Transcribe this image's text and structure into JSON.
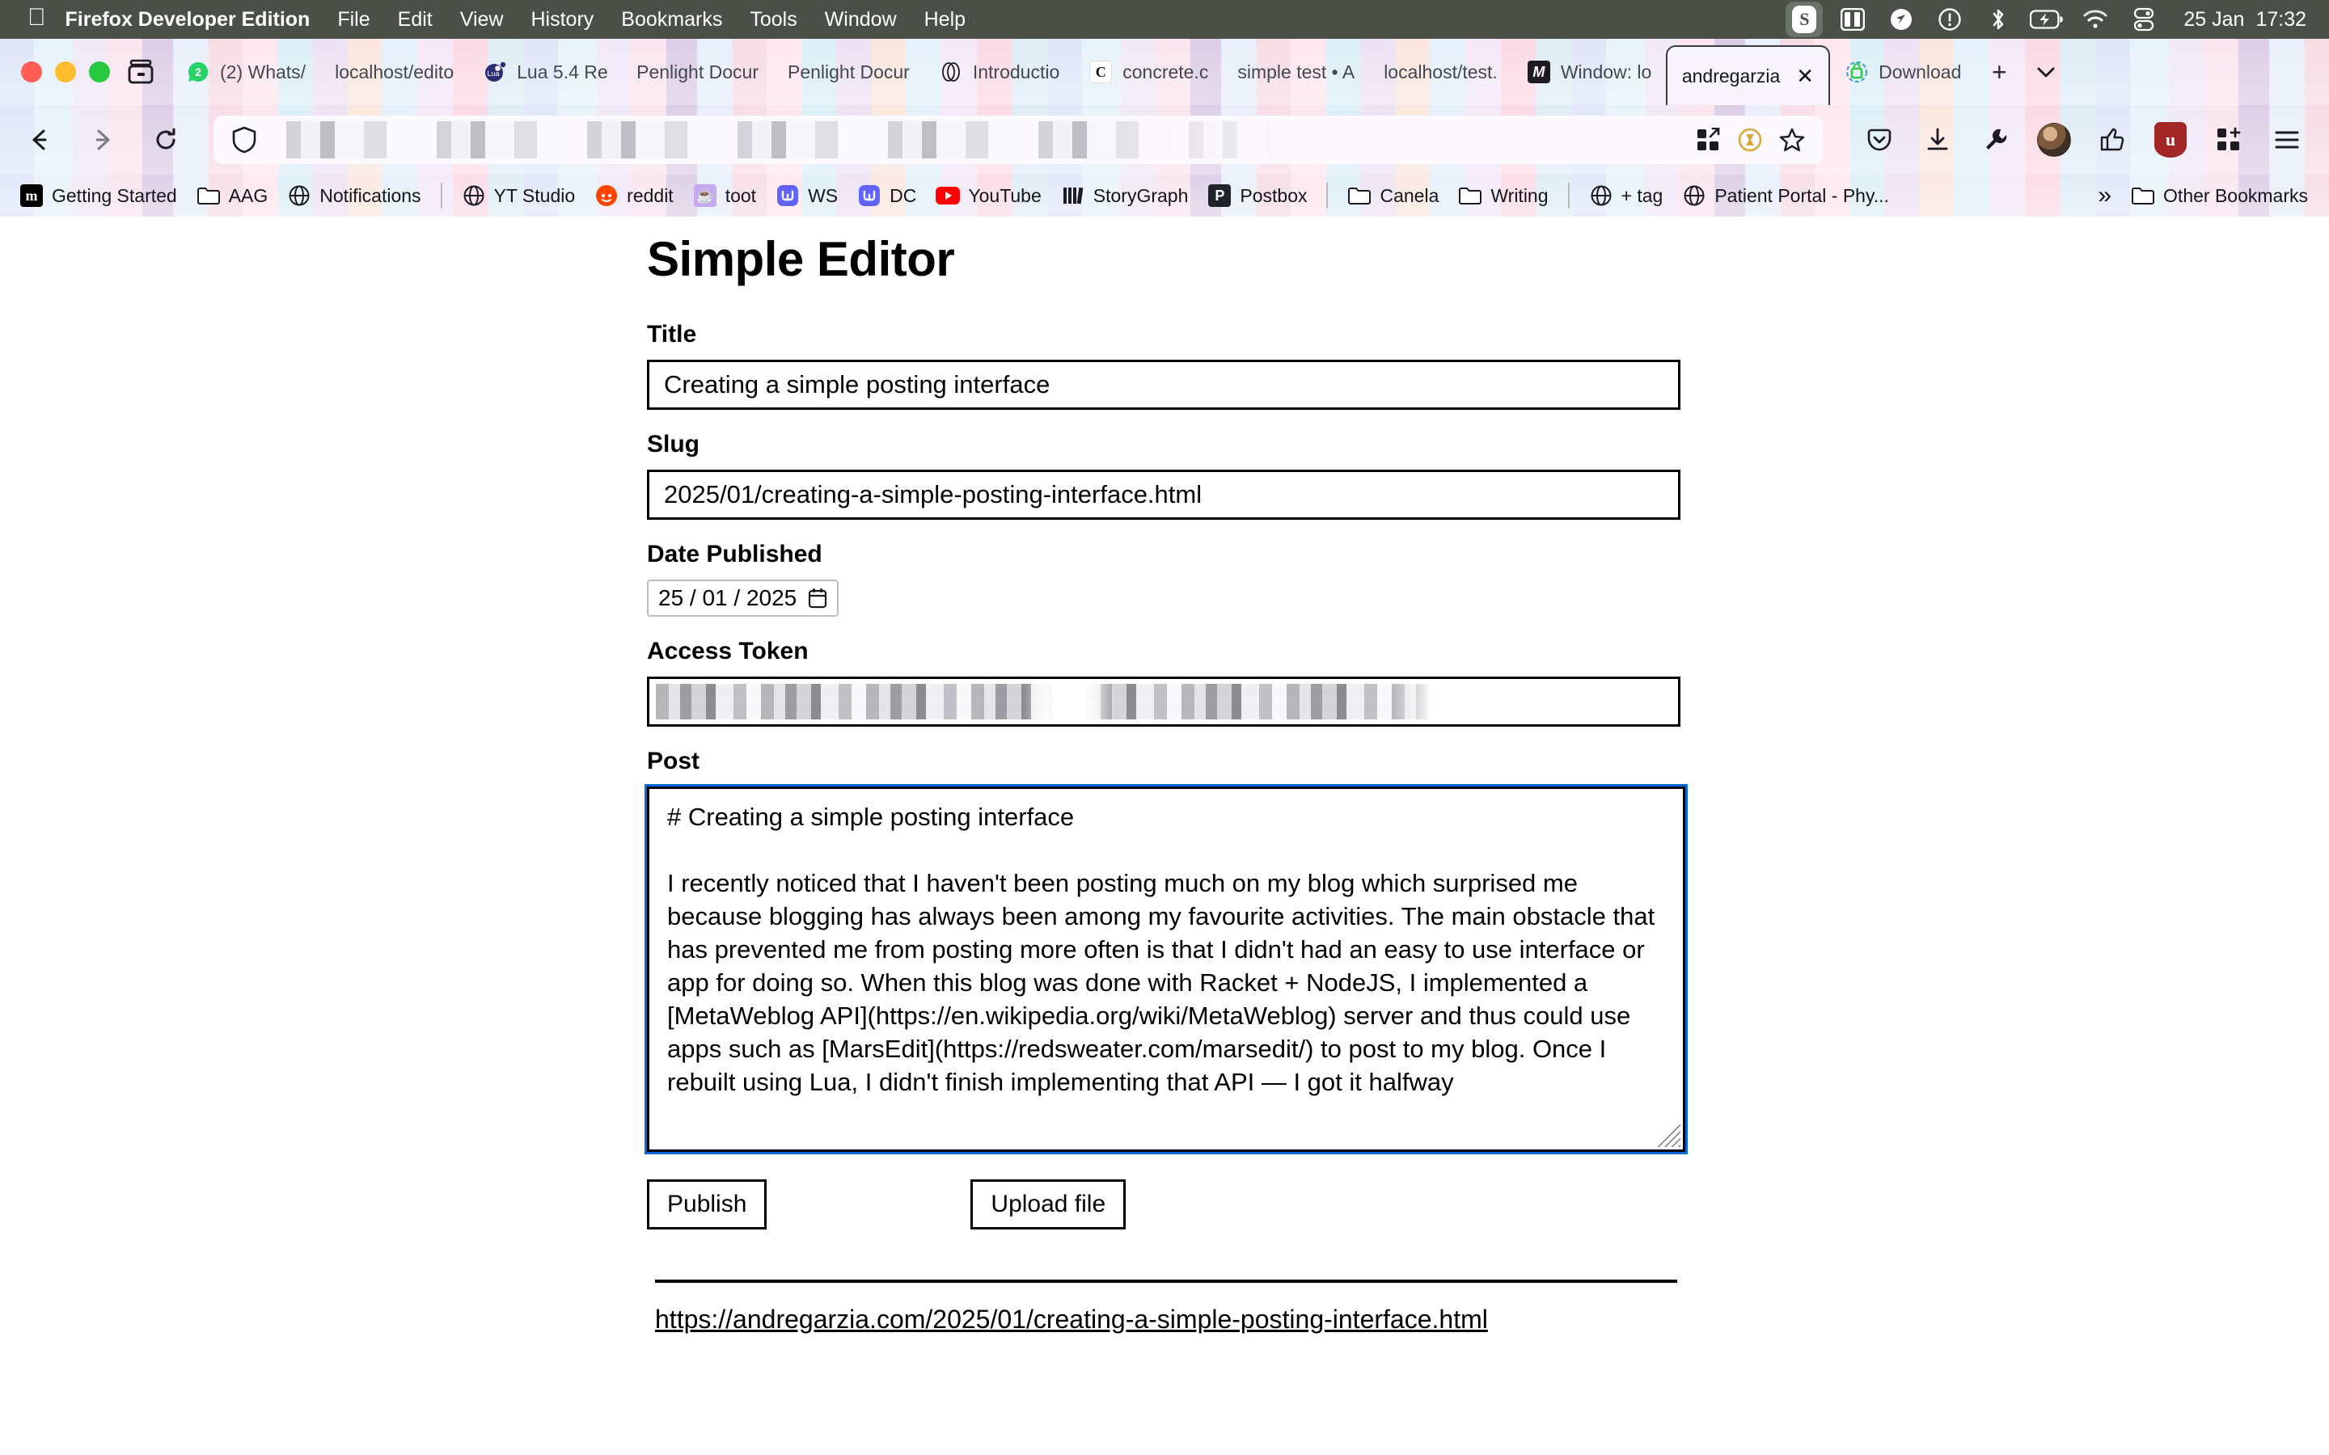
{
  "menubar": {
    "apple_icon": "apple-logo-icon",
    "app_name": "Firefox Developer Edition",
    "items": [
      "File",
      "Edit",
      "View",
      "History",
      "Bookmarks",
      "Tools",
      "Window",
      "Help"
    ],
    "status_icons": [
      "stage-manager-icon",
      "split-view-icon",
      "location-arrow-icon",
      "notification-warning-icon",
      "bluetooth-icon",
      "battery-charging-icon",
      "wifi-icon",
      "control-center-icon"
    ],
    "stage_badge_letter": "S",
    "date": "25 Jan",
    "time": "17:32"
  },
  "window_controls": {
    "close": "close-window-button",
    "minimize": "minimize-window-button",
    "maximize": "maximize-window-button",
    "list_all_tabs": "list-all-tabs-button"
  },
  "tabs": [
    {
      "label": "(2) Whats/",
      "favicon": "whatsapp-icon",
      "active": false
    },
    {
      "label": "localhost/edito",
      "favicon": "none",
      "active": false
    },
    {
      "label": "Lua 5.4 Re",
      "favicon": "lua-icon",
      "active": false
    },
    {
      "label": "Penlight Docur",
      "favicon": "none",
      "active": false
    },
    {
      "label": "Penlight Docur",
      "favicon": "none",
      "active": false
    },
    {
      "label": "Introductio",
      "favicon": "rings-icon",
      "active": false
    },
    {
      "label": "concrete.c",
      "favicon": "concrete-c-icon",
      "active": false
    },
    {
      "label": "simple test • A",
      "favicon": "none",
      "active": false
    },
    {
      "label": "localhost/test.",
      "favicon": "none",
      "active": false
    },
    {
      "label": "Window: lo",
      "favicon": "mdn-m-icon",
      "active": false
    },
    {
      "label": "andregarzia",
      "favicon": "none",
      "active": true,
      "close": "✕"
    },
    {
      "label": "Download",
      "favicon": "download-lock-icon",
      "active": false
    }
  ],
  "tabstrip": {
    "new_tab": "+",
    "chevron": "⌄"
  },
  "navbar": {
    "back": "←",
    "forward": "→",
    "reload": "↻",
    "url_value": "",
    "url_placeholder": "Search with Google or enter address",
    "shield_icon": "tracking-protection-shield-icon",
    "right_inline_icons": [
      "open-in-app-icon",
      "reader-mode-icon",
      "bookmark-star-icon"
    ],
    "toolbar_icons": [
      "pocket-save-icon",
      "downloads-icon",
      "devtools-wrench-icon",
      "account-avatar-icon",
      "extension-thumb-icon",
      "ublock-origin-icon",
      "extensions-grid-icon",
      "app-menu-icon"
    ]
  },
  "bookmarks": {
    "items": [
      {
        "label": "Getting Started",
        "favicon": "mozilla-m-icon"
      },
      {
        "label": "AAG",
        "favicon": "folder-icon"
      },
      {
        "label": "Notifications",
        "favicon": "globe-icon"
      },
      {
        "sep": true
      },
      {
        "label": "YT Studio",
        "favicon": "globe-icon"
      },
      {
        "label": "reddit",
        "favicon": "reddit-icon"
      },
      {
        "label": "toot",
        "favicon": "toot-icon"
      },
      {
        "label": "WS",
        "favicon": "mastodon-icon"
      },
      {
        "label": "DC",
        "favicon": "mastodon-icon"
      },
      {
        "label": "YouTube",
        "favicon": "youtube-icon"
      },
      {
        "label": "StoryGraph",
        "favicon": "storygraph-icon"
      },
      {
        "label": "Postbox",
        "favicon": "postbox-p-icon"
      },
      {
        "sep": true
      },
      {
        "label": "Canela",
        "favicon": "folder-icon"
      },
      {
        "label": "Writing",
        "favicon": "folder-icon"
      },
      {
        "sep": true
      },
      {
        "label": "+ tag",
        "favicon": "globe-icon"
      },
      {
        "label": "Patient Portal - Phy...",
        "favicon": "globe-icon"
      }
    ],
    "overflow": "»",
    "other_bookmarks": {
      "label": "Other Bookmarks",
      "favicon": "folder-icon"
    }
  },
  "page": {
    "heading": "Simple Editor",
    "title": {
      "label": "Title",
      "value": "Creating a simple posting interface"
    },
    "slug": {
      "label": "Slug",
      "value": "2025/01/creating-a-simple-posting-interface.html"
    },
    "date_published": {
      "label": "Date Published",
      "day": "25",
      "month": "01",
      "year": "2025",
      "value": "25 / 01 / 2025",
      "picker_icon": "calendar-icon"
    },
    "access_token": {
      "label": "Access Token",
      "value": ""
    },
    "post": {
      "label": "Post",
      "value": "# Creating a simple posting interface\n\nI recently noticed that I haven't been posting much on my blog which surprised me because blogging has always been among my favourite activities. The main obstacle that has prevented me from posting more often is that I didn't had an easy to use interface or app for doing so. When this blog was done with Racket + NodeJS, I implemented a [MetaWeblog API](https://en.wikipedia.org/wiki/MetaWeblog) server and thus could use apps such as [MarsEdit](https://redsweater.com/marsedit/) to post to my blog. Once I rebuilt using Lua, I didn't finish implementing that API — I got it halfway"
    },
    "publish_button": "Publish",
    "upload_button": "Upload file",
    "result_url": "https://andregarzia.com/2025/01/creating-a-simple-posting-interface.html"
  },
  "colors": {
    "focus_outline": "#0a65d8",
    "menubar_bg": "#4a5048",
    "page_bg": "#ffffff",
    "text": "#000000"
  }
}
